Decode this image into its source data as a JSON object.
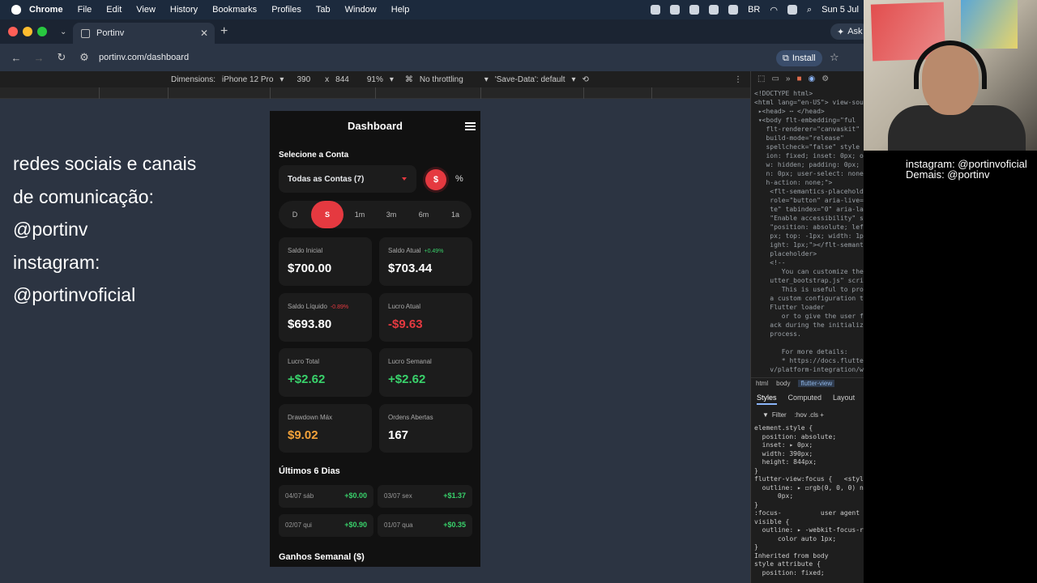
{
  "menubar": {
    "app": "Chrome",
    "items": [
      "File",
      "Edit",
      "View",
      "History",
      "Bookmarks",
      "Profiles",
      "Tab",
      "Window",
      "Help"
    ],
    "status_text": "BR",
    "clock": "Sun 5 Jul"
  },
  "tab": {
    "title": "Portinv",
    "ask_label": "Ask"
  },
  "address": {
    "url": "portinv.com/dashboard",
    "install_label": "Install"
  },
  "device_toolbar": {
    "dimensions_label": "Dimensions:",
    "device": "iPhone 12 Pro",
    "width": "390",
    "times": "x",
    "height": "844",
    "zoom": "91%",
    "throttling": "No throttling",
    "save_data": "'Save-Data': default"
  },
  "overlay": {
    "line1": "redes sociais e canais",
    "line2": "de comunicação:",
    "line3": "@portinv",
    "line4": "instagram:",
    "line5": "@portinvoficial"
  },
  "app": {
    "title": "Dashboard",
    "select_account_label": "Selecione a Conta",
    "account_dropdown": "Todas as Contas (7)",
    "currency_symbol": "$",
    "percent_symbol": "%",
    "periods": [
      "D",
      "S",
      "1m",
      "3m",
      "6m",
      "1a"
    ],
    "active_period": "S",
    "cards": [
      {
        "label": "Saldo Inicial",
        "badge": "",
        "value": "$700.00",
        "color": "#ffffff"
      },
      {
        "label": "Saldo Atual",
        "badge": "+0.49%",
        "badge_color": "#39d26b",
        "value": "$703.44",
        "color": "#ffffff"
      },
      {
        "label": "Saldo Líquido",
        "badge": "-0.89%",
        "badge_color": "#e53940",
        "value": "$693.80",
        "color": "#ffffff"
      },
      {
        "label": "Lucro Atual",
        "badge": "",
        "value": "-$9.63",
        "color": "#e53940"
      },
      {
        "label": "Lucro Total",
        "badge": "",
        "value": "+$2.62",
        "color": "#39d26b"
      },
      {
        "label": "Lucro Semanal",
        "badge": "",
        "value": "+$2.62",
        "color": "#39d26b"
      },
      {
        "label": "Drawdown Máx",
        "badge": "",
        "value": "$9.02",
        "color": "#f3a23a"
      },
      {
        "label": "Ordens Abertas",
        "badge": "",
        "value": "167",
        "color": "#ffffff"
      }
    ],
    "last_days_label": "Últimos 6 Dias",
    "days": [
      {
        "date": "04/07 sáb",
        "gain": "+$0.00"
      },
      {
        "date": "03/07 sex",
        "gain": "+$1.37"
      },
      {
        "date": "02/07 qui",
        "gain": "+$0.90"
      },
      {
        "date": "01/07 qua",
        "gain": "+$0.35"
      }
    ],
    "weekly_label": "Ganhos Semanal ($)"
  },
  "devtools": {
    "code": "<!DOCTYPE html>\n<html lang=\"en-US\"> view-sou\n ▸<head> ⋯ </head>\n ▾<body flt-embedding=\"ful\n   flt-renderer=\"canvaskit\"\n   build-mode=\"release\"\n   spellcheck=\"false\" style\n   ion: fixed; inset: 0px; overflo\n   w: hidden; padding: 0px; margi\n   n: 0px; user-select: none; touc\n   h-action: none;\">\n    <flt-semantics-placeholder\n    role=\"button\" aria-live=\"poli\n    te\" tabindex=\"0\" aria-label=\n    \"Enable accessibility\" style=\n    \"position: absolute; left: -1\n    px; top: -1px; width: 1px; he\n    ight: 1px;\"></flt-semantics-\n    placeholder>\n    <!--\n       You can customize the \"fl\n    utter_bootstrap.js\" script.\n       This is useful to provide\n    a custom configuration to the\n    Flutter loader\n       or to give the user feedb\n    ack during the initialization\n    process.\n\n       For more details:\n       * https://docs.flutter.de\n    v/platform-integration/web/in",
    "crumbs": [
      "html",
      "body",
      "flutter-view"
    ],
    "style_tabs": [
      "Styles",
      "Computed",
      "Layout",
      "»"
    ],
    "filter_label": "Filter",
    "filter_extras": ":hov .cls +",
    "styles_text": "element.style {\n  position: absolute;\n  inset: ▸ 0px;\n  width: 390px;\n  height: 844px;\n}\nflutter-view:focus {   <style>\n  outline: ▸ ◻rgb(0, 0, 0) none\n      0px;\n}\n:focus-          user agent stylesheet\nvisible {\n  outline: ▸ -webkit-focus-ring-\n      color auto 1px;\n}\nInherited from body\nstyle attribute {\n  position: fixed;"
  },
  "cam_caption": "instagram: @portinvoficial\nDemais: @portinv"
}
